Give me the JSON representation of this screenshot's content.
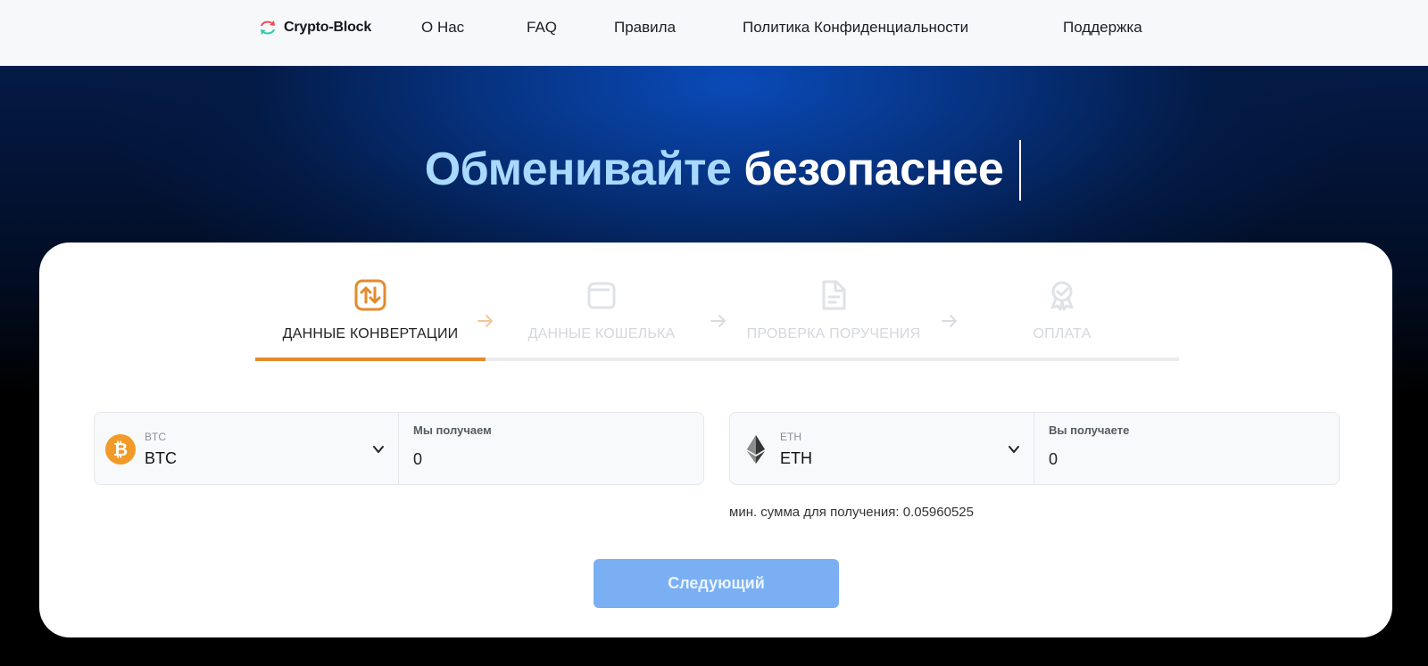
{
  "header": {
    "brand": "Crypto-Block",
    "nav": [
      "О Нас",
      "FAQ",
      "Правила",
      "Политика Конфиденциальности",
      "Поддержка"
    ]
  },
  "hero": {
    "title_part1": "Обменивайте",
    "title_part2": "безопаснее"
  },
  "steps": [
    {
      "label": "ДАННЫЕ КОНВЕРТАЦИИ",
      "icon": "swap-arrows-icon",
      "active": true
    },
    {
      "label": "ДАННЫЕ КОШЕЛЬКА",
      "icon": "wallet-icon",
      "active": false
    },
    {
      "label": "ПРОВЕРКА ПОРУЧЕНИЯ",
      "icon": "document-icon",
      "active": false
    },
    {
      "label": "ОПЛАТА",
      "icon": "badge-icon",
      "active": false
    }
  ],
  "send": {
    "coin_code": "BTC",
    "coin_name": "BTC",
    "icon": "bitcoin-icon",
    "amount_label": "Мы получаем",
    "amount_value": "0"
  },
  "receive": {
    "coin_code": "ETH",
    "coin_name": "ETH",
    "icon": "ethereum-icon",
    "amount_label": "Вы получаете",
    "amount_value": "0"
  },
  "min_note": "мин. сумма для получения: 0.05960525",
  "next_button": "Следующий",
  "colors": {
    "accent": "#e48a2d",
    "button": "#7ab0f3",
    "hero_highlight": "#a9d9ff",
    "bitcoin": "#f29a27"
  }
}
